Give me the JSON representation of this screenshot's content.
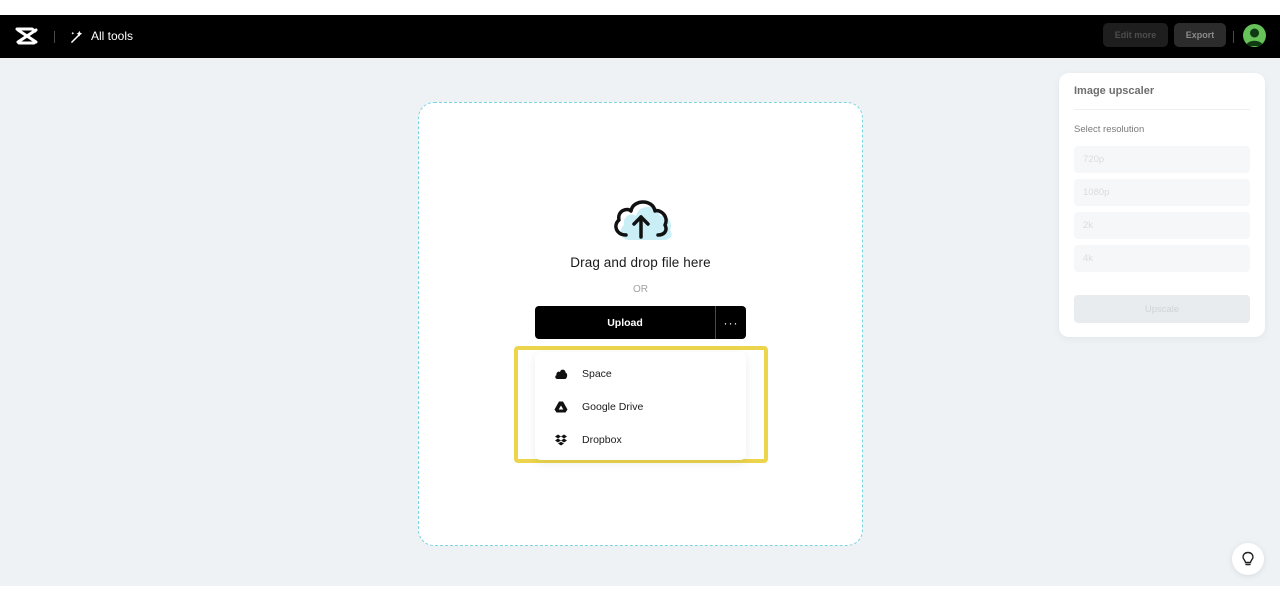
{
  "header": {
    "all_tools_label": "All tools",
    "edit_more_label": "Edit more",
    "export_label": "Export",
    "logo_icon": "capcut-logo-icon",
    "all_tools_icon": "magic-wand-icon"
  },
  "upload": {
    "drag_text": "Drag and drop file here",
    "or_text": "OR",
    "upload_label": "Upload",
    "more_label": "···",
    "menu_items": [
      {
        "label": "Space",
        "icon": "cloud-icon"
      },
      {
        "label": "Google Drive",
        "icon": "google-drive-icon"
      },
      {
        "label": "Dropbox",
        "icon": "dropbox-icon"
      }
    ]
  },
  "panel": {
    "title": "Image upscaler",
    "select_label": "Select resolution",
    "resolutions": [
      "720p",
      "1080p",
      "2k",
      "4k"
    ],
    "upscale_label": "Upscale"
  },
  "colors": {
    "topbar": "#000000",
    "workspace": "#eef2f5",
    "dropzone_border": "#7dd3df",
    "highlight": "#ecd54c",
    "avatar": "#67c25a"
  }
}
